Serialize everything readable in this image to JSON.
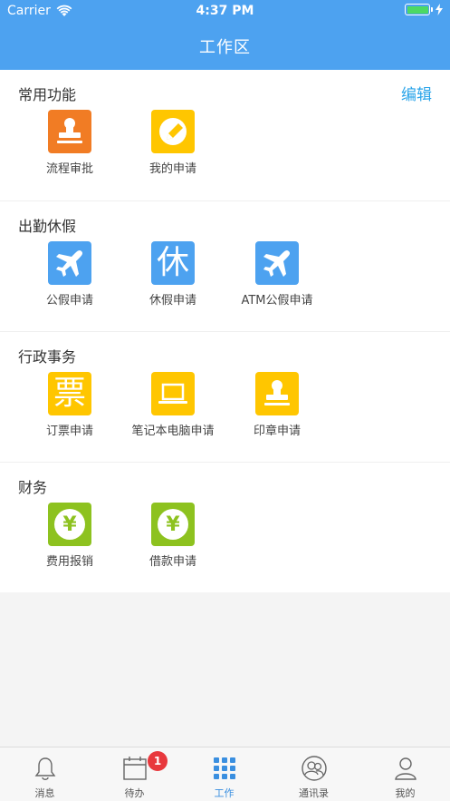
{
  "status_bar": {
    "carrier": "Carrier",
    "time": "4:37 PM"
  },
  "header": {
    "title": "工作区"
  },
  "sections": [
    {
      "title": "常用功能",
      "edit_label": "编辑",
      "items": [
        {
          "label": "流程审批",
          "icon": "stamp-icon",
          "color": "#f17c24"
        },
        {
          "label": "我的申请",
          "icon": "pencil-circle-icon",
          "color": "#ffc600"
        }
      ]
    },
    {
      "title": "出勤休假",
      "items": [
        {
          "label": "公假申请",
          "icon": "airplane-icon",
          "color": "#4da2f0"
        },
        {
          "label": "休假申请",
          "icon": "rest-character-icon",
          "icon_text": "休",
          "color": "#4da2f0"
        },
        {
          "label": "ATM公假申请",
          "icon": "airplane-icon",
          "color": "#4da2f0"
        }
      ]
    },
    {
      "title": "行政事务",
      "items": [
        {
          "label": "订票申请",
          "icon": "ticket-character-icon",
          "icon_text": "票",
          "color": "#ffc600"
        },
        {
          "label": "笔记本电脑申请",
          "icon": "laptop-icon",
          "color": "#ffc600"
        },
        {
          "label": "印章申请",
          "icon": "stamp-icon",
          "color": "#ffc600"
        }
      ]
    },
    {
      "title": "财务",
      "items": [
        {
          "label": "费用报销",
          "icon": "yen-coin-icon",
          "icon_text": "¥",
          "color": "#8dc21f"
        },
        {
          "label": "借款申请",
          "icon": "yen-coin-icon",
          "icon_text": "¥",
          "color": "#8dc21f"
        }
      ]
    }
  ],
  "tabbar": {
    "tabs": [
      {
        "label": "消息",
        "icon": "bell-icon"
      },
      {
        "label": "待办",
        "icon": "calendar-icon",
        "badge": "1"
      },
      {
        "label": "工作",
        "icon": "grid-icon",
        "active": true
      },
      {
        "label": "通讯录",
        "icon": "contacts-icon"
      },
      {
        "label": "我的",
        "icon": "person-icon"
      }
    ]
  },
  "colors": {
    "header": "#4da2f0",
    "accent_link": "#2aa4e9",
    "active_tab": "#3a8fe0",
    "badge": "#e8383d"
  }
}
